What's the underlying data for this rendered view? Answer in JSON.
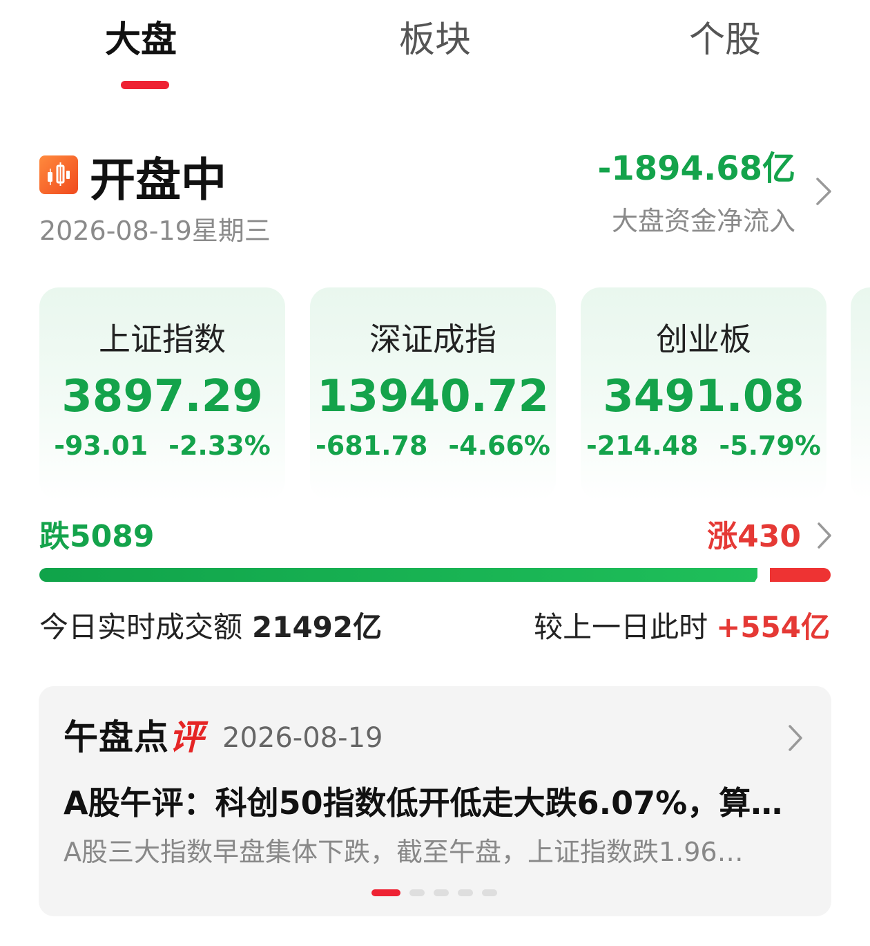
{
  "tabs": [
    {
      "label": "大盘",
      "active": true
    },
    {
      "label": "板块",
      "active": false
    },
    {
      "label": "个股",
      "active": false
    }
  ],
  "status": {
    "title": "开盘中",
    "date": "2026-08-19星期三",
    "icon": "candlestick-chart-icon"
  },
  "fund_flow": {
    "value": "-1894.68亿",
    "label": "大盘资金净流入"
  },
  "indices": [
    {
      "name": "上证指数",
      "value": "3897.29",
      "change": "-93.01",
      "change_pct": "-2.33%"
    },
    {
      "name": "深证成指",
      "value": "13940.72",
      "change": "-681.78",
      "change_pct": "-4.66%"
    },
    {
      "name": "创业板",
      "value": "3491.08",
      "change": "-214.48",
      "change_pct": "-5.79%"
    }
  ],
  "breadth": {
    "fall_label": "跌5089",
    "rise_label": "涨430",
    "fall_count": 5089,
    "rise_count": 430
  },
  "turnover": {
    "label": "今日实时成交额",
    "value": "21492亿",
    "compare_label": "较上一日此时",
    "compare_value": "+554亿"
  },
  "commentary": {
    "brand": "午盘点",
    "brand_accent": "评",
    "date": "2026-08-19",
    "headline": "A股午评：科创50指数低开低走大跌6.07%，算…",
    "summary": "A股三大指数早盘集体下跌，截至午盘，上证指数跌1.96…",
    "page_count": 5,
    "current_page": 1
  },
  "colors": {
    "down": "#14a34b",
    "up": "#e53935",
    "accent": "#ee2233"
  }
}
